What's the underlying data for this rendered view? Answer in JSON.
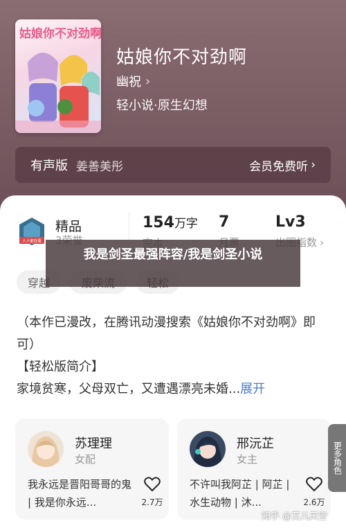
{
  "book": {
    "cover_text": "姑娘你不对劲啊",
    "title": "姑娘你不对劲啊",
    "author": "幽祝",
    "author_chevron": "›",
    "category": "轻小说·原生幻想"
  },
  "audio": {
    "label": "有声版",
    "narrator": "姜善美彤",
    "action": "会员免费听",
    "action_chevron": "›"
  },
  "stats": {
    "rank_name": "精品",
    "rank_sub": "3荣誉",
    "badge_text": "人人都在看",
    "words_num": "154",
    "words_unit": "万字",
    "words_label": "完本",
    "tickets_num": "7",
    "tickets_label": "月票",
    "level_num": "Lv3",
    "level_label": "出圈指数",
    "level_chevron": "›"
  },
  "overlay": {
    "text": "我是剑圣最强阵容/我是剑圣小说"
  },
  "tags": [
    "穿越",
    "废柴流",
    "轻松"
  ],
  "desc": {
    "line1": "（本作已漫改，在腾讯动漫搜索《姑娘你不对劲啊》即可）",
    "line2": "【轻松版简介】",
    "line3": "家境贫寒，父母双亡，又遭遇漂亮未婚...",
    "expand": "展开"
  },
  "roles": [
    {
      "name": "苏理理",
      "type": "女配",
      "quote": "我永远是晋阳哥哥的鬼 | 我是你永远...",
      "likes": "2.7万"
    },
    {
      "name": "邢沅芷",
      "type": "女主",
      "quote": "不许叫我阿芷 | 阿芷 | 水生动物 | 沐...",
      "likes": "2.6万"
    }
  ],
  "more_tab": "更多角色",
  "watermark": "知乎 @艾儿天空"
}
